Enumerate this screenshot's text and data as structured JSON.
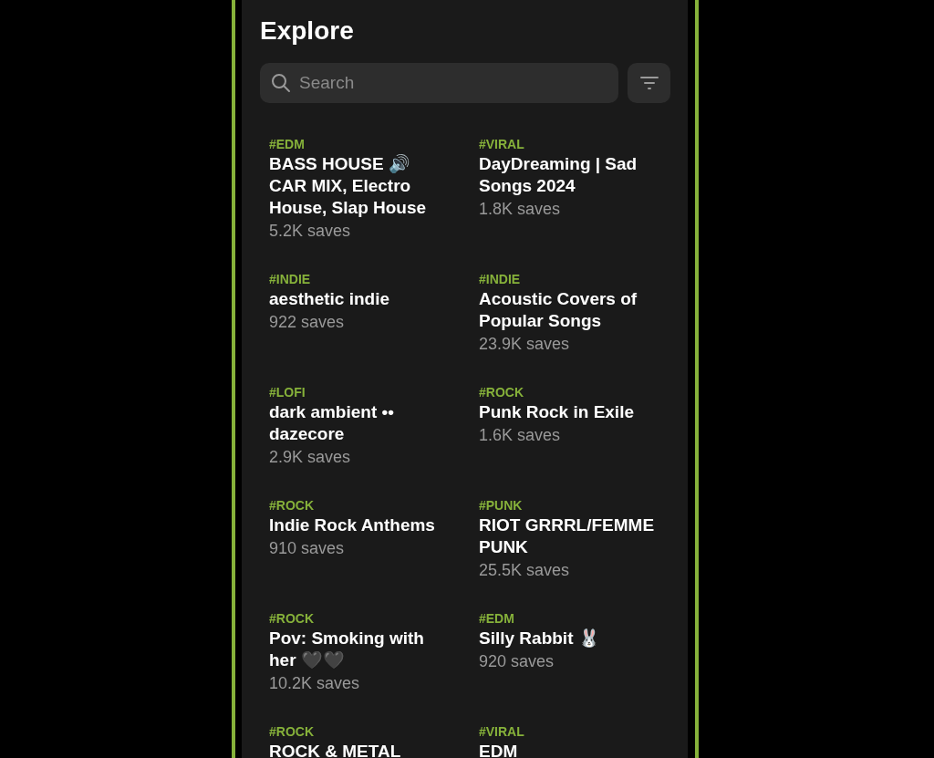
{
  "title": "Explore",
  "search": {
    "placeholder": "Search"
  },
  "playlists": [
    {
      "tag": "#EDM",
      "name": "BASS HOUSE 🔊 CAR MIX, Electro House, Slap House",
      "saves": "5.2K saves"
    },
    {
      "tag": "#VIRAL",
      "name": "DayDreaming | Sad Songs 2024",
      "saves": "1.8K saves"
    },
    {
      "tag": "#INDIE",
      "name": "aesthetic indie",
      "saves": "922 saves"
    },
    {
      "tag": "#INDIE",
      "name": "Acoustic Covers of Popular Songs",
      "saves": "23.9K saves"
    },
    {
      "tag": "#LOFI",
      "name": "dark ambient •• dazecore",
      "saves": "2.9K saves"
    },
    {
      "tag": "#ROCK",
      "name": "Punk Rock in Exile",
      "saves": "1.6K saves"
    },
    {
      "tag": "#ROCK",
      "name": "Indie Rock Anthems",
      "saves": "910 saves"
    },
    {
      "tag": "#PUNK",
      "name": "RIOT GRRRL/FEMME PUNK",
      "saves": "25.5K saves"
    },
    {
      "tag": "#ROCK",
      "name": "Pov: Smoking with her  🖤🖤",
      "saves": "10.2K saves"
    },
    {
      "tag": "#EDM",
      "name": "Silly Rabbit 🐰",
      "saves": "920 saves"
    },
    {
      "tag": "#ROCK",
      "name": "ROCK & METAL"
    },
    {
      "tag": "#VIRAL",
      "name": "EDM"
    }
  ]
}
